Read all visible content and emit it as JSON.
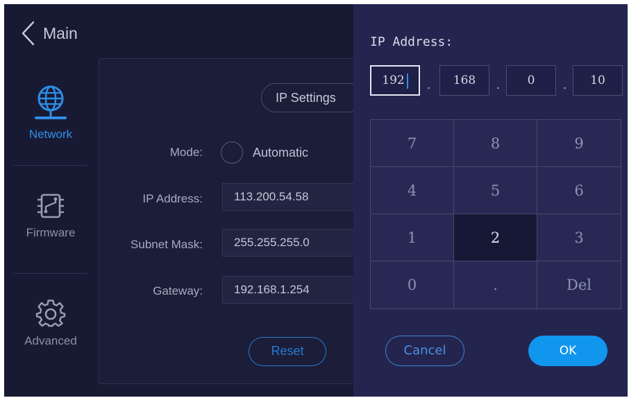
{
  "header": {
    "back_label": "Main"
  },
  "nav": {
    "network": "Network",
    "firmware": "Firmware",
    "advanced": "Advanced"
  },
  "tabs": {
    "ip_settings": "IP Settings"
  },
  "form": {
    "mode_label": "Mode:",
    "mode_value": "Automatic",
    "ip_label": "IP Address:",
    "ip_value": "113.200.54.58",
    "mask_label": "Subnet Mask:",
    "mask_value": "255.255.255.0",
    "gateway_label": "Gateway:",
    "gateway_value": "192.168.1.254",
    "reset_label": "Reset"
  },
  "dialog": {
    "title": "IP Address:",
    "octets": [
      "192",
      "168",
      "0",
      "10"
    ],
    "separator": ".",
    "keys": [
      "7",
      "8",
      "9",
      "4",
      "5",
      "6",
      "1",
      "2",
      "3",
      "0",
      ".",
      "Del"
    ],
    "pressed_key": "2",
    "cancel_label": "Cancel",
    "ok_label": "OK"
  },
  "colors": {
    "background": "#181a34",
    "overlay": "#24254f",
    "accent": "#2f8ee6",
    "ok_button": "#1196ee"
  },
  "icons": {
    "back": "chevron-left-icon",
    "network": "globe-network-icon",
    "firmware": "chip-icon",
    "advanced": "gear-icon"
  }
}
